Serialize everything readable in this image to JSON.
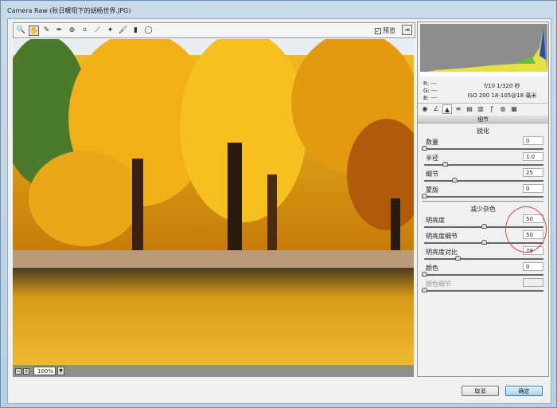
{
  "window": {
    "title": "Camera Raw (秋日暖阳下的胡杨世界.JPG)"
  },
  "toolbar": {
    "tools": [
      "zoom-icon",
      "hand-icon",
      "white-balance-icon",
      "color-sampler-icon",
      "target-adjust-icon",
      "crop-icon",
      "straighten-icon",
      "retouch-icon",
      "red-eye-icon",
      "adjustment-brush-icon",
      "graduated-filter-icon"
    ],
    "preview_label": "预览",
    "preview_checked": true
  },
  "zoom": {
    "value": "100%"
  },
  "info": {
    "r": "R: ---",
    "g": "G: ---",
    "b": "B: ---",
    "aperture_shutter": "f/10   1/320 秒",
    "iso_lens": "ISO 200   18-105@18 毫米"
  },
  "panel": {
    "title": "细节",
    "sharpen": {
      "title": "锐化",
      "rows": [
        {
          "label": "数量",
          "value": "0",
          "pct": 0
        },
        {
          "label": "半径",
          "value": "1.0",
          "pct": 17
        },
        {
          "label": "细节",
          "value": "25",
          "pct": 25
        },
        {
          "label": "蒙版",
          "value": "0",
          "pct": 0
        }
      ]
    },
    "noise": {
      "title": "减少杂色",
      "rows": [
        {
          "label": "明亮度",
          "value": "50",
          "pct": 50
        },
        {
          "label": "明亮度细节",
          "value": "50",
          "pct": 50
        },
        {
          "label": "明亮度对比",
          "value": "28",
          "pct": 28
        },
        {
          "label": "颜色",
          "value": "0",
          "pct": 0
        },
        {
          "label": "颜色细节",
          "value": "",
          "pct": 0,
          "disabled": true
        }
      ]
    }
  },
  "buttons": {
    "cancel": "取消",
    "ok": "确定"
  },
  "colors": {
    "annotation_circle": "#d44444",
    "ok_button": "#a9d4ee"
  }
}
